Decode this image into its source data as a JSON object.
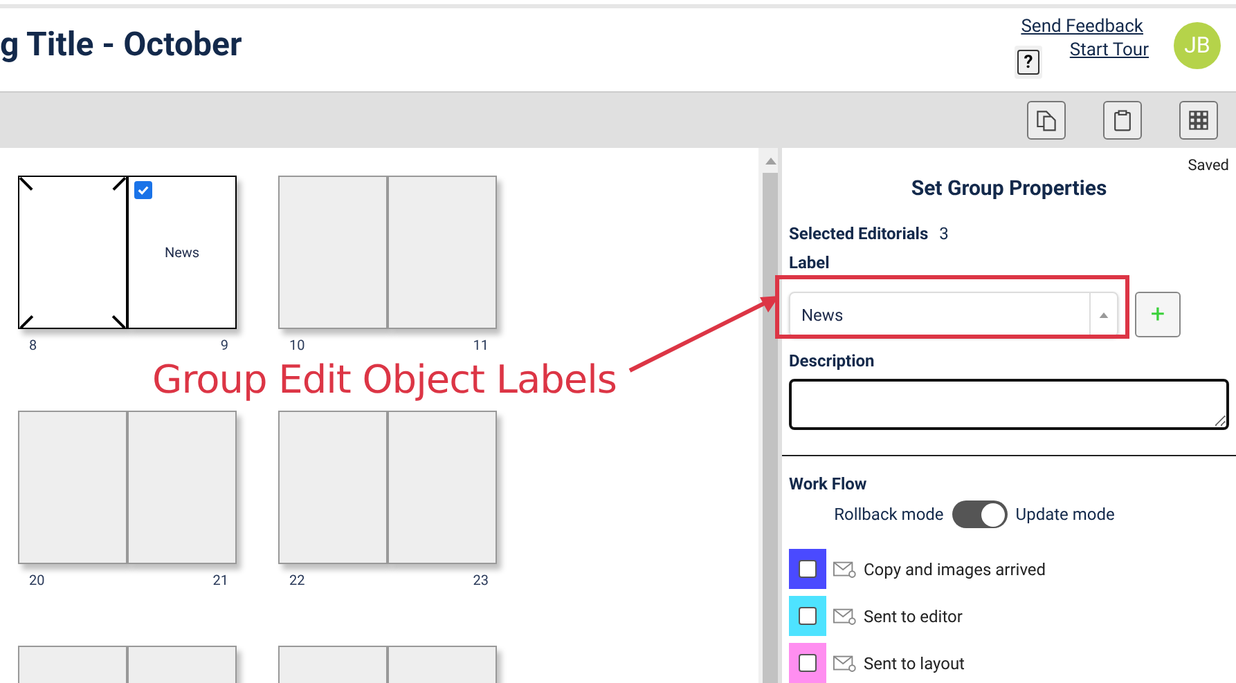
{
  "header": {
    "title": "g Title - October",
    "links": [
      "Send Feedback",
      "Start Tour"
    ],
    "help": "?",
    "avatar": "JB"
  },
  "spread_rows": [
    [
      {
        "pages": [
          {
            "number": "8",
            "selected": true,
            "checked": false
          },
          {
            "number": "9",
            "selected": true,
            "checked": true,
            "label": "News"
          }
        ]
      },
      {
        "pages": [
          {
            "number": "10",
            "selected": false
          },
          {
            "number": "11",
            "selected": false
          }
        ]
      }
    ],
    [
      {
        "pages": [
          {
            "number": "20",
            "selected": false
          },
          {
            "number": "21",
            "selected": false
          }
        ]
      },
      {
        "pages": [
          {
            "number": "22",
            "selected": false
          },
          {
            "number": "23",
            "selected": false
          }
        ]
      }
    ],
    [
      {
        "pages": [
          {
            "selected": false
          },
          {
            "selected": false
          }
        ]
      },
      {
        "pages": [
          {
            "selected": false
          },
          {
            "selected": false
          }
        ]
      }
    ]
  ],
  "annotation": {
    "text": "Group Edit Object Labels"
  },
  "panel": {
    "status": "Saved",
    "title": "Set Group Properties",
    "selected_label": "Selected Editorials",
    "selected_count": "3",
    "label_label": "Label",
    "label_value": "News",
    "add": "+",
    "description_label": "Description",
    "workflow_title": "Work Flow",
    "toggle": {
      "off_label": "Rollback mode",
      "on_label": "Update mode",
      "on": true
    },
    "workflow": [
      {
        "label": "Copy and images arrived",
        "color": "#4a4aff",
        "checked": false
      },
      {
        "label": "Sent to editor",
        "color": "#4ee3ff",
        "checked": false
      },
      {
        "label": "Sent to layout",
        "color": "#ff8ef0",
        "checked": false
      }
    ]
  }
}
